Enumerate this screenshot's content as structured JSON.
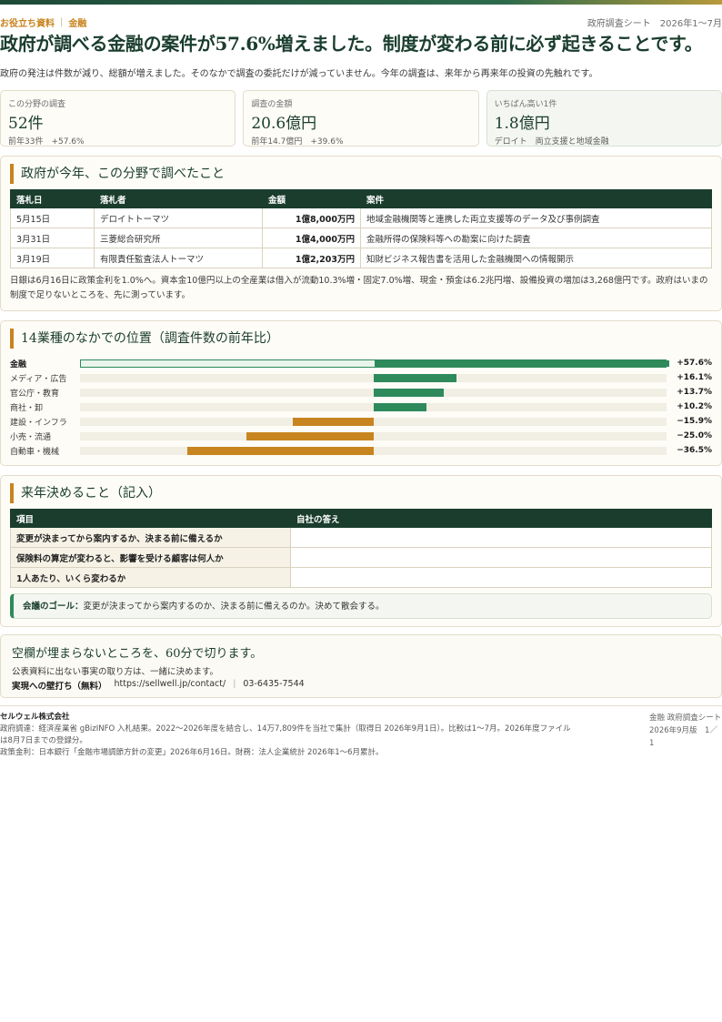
{
  "header": {
    "tag1": "お役立ち資料",
    "tag2": "金融",
    "separator": "|",
    "right": "政府調査シート　2026年1〜7月"
  },
  "title": "政府が調べる金融の案件が57.6%増えました。制度が変わる前に必ず起きることです。",
  "lead": "政府の発注は件数が減り、総額が増えました。そのなかで調査の委託だけが減っていません。今年の調査は、来年から再来年の投資の先触れです。",
  "stats": [
    {
      "label": "この分野の調査",
      "value": "52件",
      "sub": "前年33件　+57.6%"
    },
    {
      "label": "調査の金額",
      "value": "20.6億円",
      "sub": "前年14.7億円　+39.6%"
    },
    {
      "label": "いちばん高い1件",
      "value": "1.8億円",
      "sub": "デロイト　両立支援と地域金融"
    }
  ],
  "survey": {
    "title": "政府が今年、この分野で調べたこと",
    "columns": [
      "落札日",
      "落札者",
      "金額",
      "案件"
    ],
    "rows": [
      [
        "5月15日",
        "デロイトトーマツ",
        "1億8,000万円",
        "地域金融機関等と連携した両立支援等のデータ及び事例調査"
      ],
      [
        "3月31日",
        "三菱総合研究所",
        "1億4,000万円",
        "金融所得の保険料等への勘案に向けた調査"
      ],
      [
        "3月19日",
        "有限責任監査法人トーマツ",
        "1億2,203万円",
        "知財ビジネス報告書を活用した金融機関への情報開示"
      ]
    ],
    "note": "日銀は6月16日に政策金利を1.0%へ。資本金10億円以上の全産業は借入が流動10.3%増・固定7.0%増、現金・預金は6.2兆円増、設備投資の増加は3,268億円です。政府はいまの制度で足りないところを、先に測っています。"
  },
  "chart_data": {
    "type": "bar",
    "orientation": "horizontal",
    "title": "14業種のなかでの位置（調査件数の前年比）",
    "categories": [
      "金融",
      "メディア・広告",
      "官公庁・教育",
      "商社・卸",
      "建設・インフラ",
      "小売・流通",
      "自動車・機械"
    ],
    "values": [
      57.6,
      16.1,
      13.7,
      10.2,
      -15.9,
      -25.0,
      -36.5
    ],
    "value_labels": [
      "+57.6%",
      "+16.1%",
      "+13.7%",
      "+10.2%",
      "−15.9%",
      "−25.0%",
      "−36.5%"
    ],
    "highlight": "金融",
    "xlim": [
      -57.6,
      57.6
    ],
    "colors": {
      "positive": "#2e8a5a",
      "negative": "#c8841f"
    }
  },
  "decide": {
    "title": "来年決めること（記入）",
    "columns": [
      "項目",
      "自社の答え"
    ],
    "rows": [
      "変更が決まってから案内するか、決まる前に備えるか",
      "保険料の算定が変わると、影響を受ける顧客は何人か",
      "1人あたり、いくら変わるか"
    ],
    "goal_label": "会議のゴール：",
    "goal_text": "変更が決まってから案内するのか、決まる前に備えるのか。決めて散会する。"
  },
  "cta": {
    "headline": "空欄が埋まらないところを、60分で切ります。",
    "text": "公表資料に出ない事実の取り方は、一緒に決めます。",
    "contact_label": "実現への壁打ち（無料）",
    "url": "https://sellwell.jp/contact/",
    "separator": "|",
    "phone": "03-6435-7544"
  },
  "footer": {
    "company": "セルウェル株式会社",
    "line1": "政府調達：経済産業省 gBizINFO 入札結果。2022〜2026年度を結合し、14万7,809件を当社で集計（取得日 2026年9月1日）。比較は1〜7月。2026年度ファイルは8月7日までの登録分。",
    "line2": "政策金利：日本銀行「金融市場調節方針の変更」2026年6月16日。財務：法人企業統計 2026年1〜6月累計。",
    "right1": "金融 政府調査シート",
    "right2": "2026年9月版　1／1"
  },
  "colors": {
    "primary": "#1a3d2e",
    "accent": "#c8841f",
    "positive": "#2e8a5a"
  }
}
